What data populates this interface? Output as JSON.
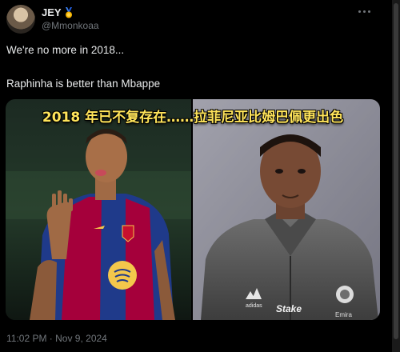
{
  "author": {
    "display_name": "JEY",
    "badge_icon": "medal-icon",
    "handle": "@Mmonkoaa"
  },
  "tweet": {
    "line1": "We're no more in 2018...",
    "line2": "Raphinha is better than Mbappe",
    "timestamp": "11:02 PM · Nov 9, 2024"
  },
  "media": {
    "caption": "2018 年已不复存在……拉菲尼亚比姆巴佩更出色",
    "left_image": "raphinha-photo",
    "right_image": "mbappe-photo",
    "jersey_colors": [
      "#a5003b",
      "#1f3a8a"
    ],
    "caption_color": "#ffe45a"
  }
}
